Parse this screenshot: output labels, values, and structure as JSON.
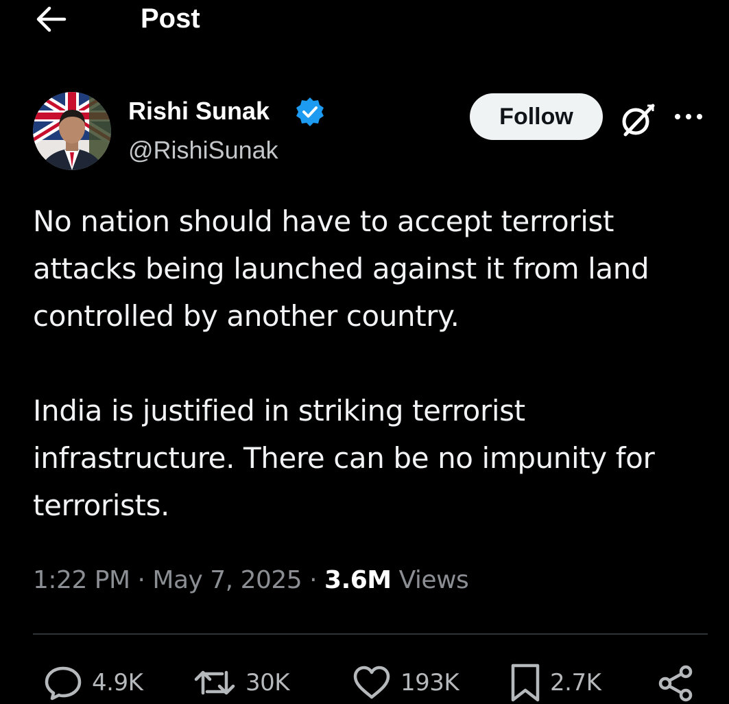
{
  "header": {
    "title": "Post",
    "back_icon": "arrow-left-icon"
  },
  "author": {
    "name": "Rishi Sunak",
    "handle": "@RishiSunak",
    "verified": true,
    "verified_color": "#1d9bf0"
  },
  "actions_top": {
    "follow_label": "Follow",
    "grok_icon": "grok-icon",
    "more_icon": "more-horizontal-icon"
  },
  "post": {
    "paragraphs": [
      "No nation should have to accept terrorist attacks being launched against it from land controlled by another country.",
      "India is justified in striking terrorist infrastructure. There can be no impunity for terrorists."
    ]
  },
  "meta": {
    "time": "1:22 PM",
    "separator": " · ",
    "date": "May 7, 2025",
    "views_count": "3.6M",
    "views_label": " Views"
  },
  "engagement": {
    "replies": "4.9K",
    "reposts": "30K",
    "likes": "193K",
    "bookmarks": "2.7K"
  },
  "colors": {
    "background": "#000000",
    "text": "#e7e9ea",
    "secondary_text": "#8b8f94",
    "follow_button_bg": "#eff3f4",
    "divider": "#2f3336"
  }
}
